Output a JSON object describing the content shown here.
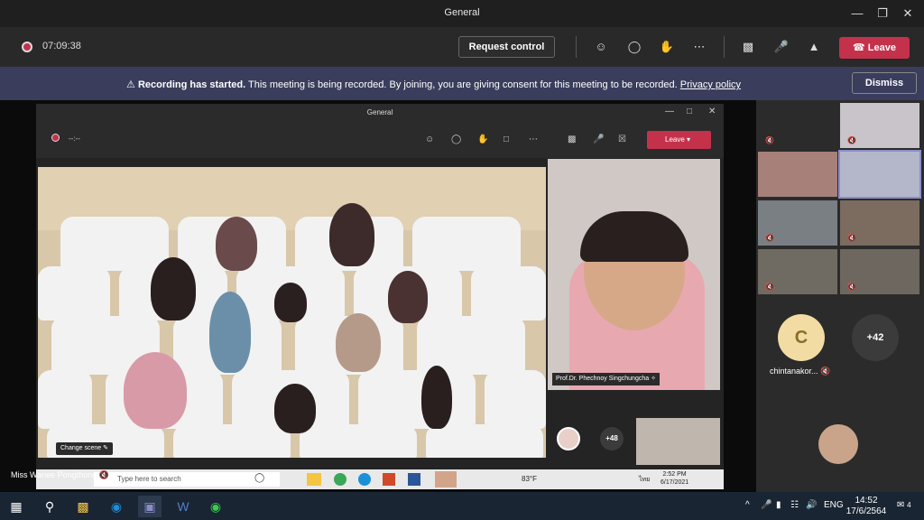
{
  "window": {
    "title": "General"
  },
  "meeting": {
    "timer": "07:09:38",
    "request_control": "Request control",
    "leave": "Leave"
  },
  "banner": {
    "bold": "Recording has started.",
    "text": " This meeting is being recorded. By joining, you are giving consent for this meeting to be recorded.",
    "link": "Privacy policy",
    "dismiss": "Dismiss"
  },
  "inner": {
    "title": "General",
    "timer": "--:--",
    "leave": "Leave",
    "change_scene": "Change scene",
    "spotlight_name": "Prof.Dr. Phechnoy Singchungcha",
    "more_count": "+48",
    "search_placeholder": "Type here to search",
    "weather": "83°F",
    "clock_time": "2:52 PM",
    "clock_date": "6/17/2021",
    "lang": "ไทย"
  },
  "presenter": "Miss Wanee Pongthong",
  "gallery": {
    "avatar_letter": "C",
    "avatar_name": "chintanakor...",
    "overflow_count": "+42"
  },
  "taskbar": {
    "lang": "ENG",
    "time": "14:52",
    "date": "17/6/2564",
    "notif_count": "4"
  },
  "colors": {
    "leave": "#c4314b",
    "banner": "#3a3d5c",
    "accent": "#6264a7"
  }
}
